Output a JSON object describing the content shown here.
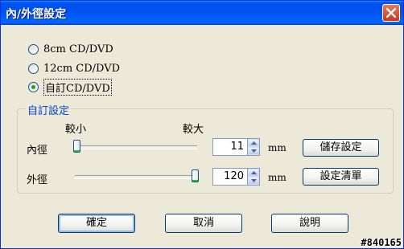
{
  "window": {
    "title": "內/外徑設定"
  },
  "disc_options": [
    {
      "label": "8cm CD/DVD",
      "checked": false
    },
    {
      "label": "12cm CD/DVD",
      "checked": false
    },
    {
      "label": "自訂CD/DVD",
      "checked": true
    }
  ],
  "custom_group": {
    "title": "自訂設定",
    "smaller_label": "較小",
    "larger_label": "較大",
    "inner": {
      "label": "內徑",
      "value": "11",
      "unit": "mm",
      "button": "儲存設定"
    },
    "outer": {
      "label": "外徑",
      "value": "120",
      "unit": "mm",
      "button": "設定清單"
    }
  },
  "buttons": {
    "ok": "確定",
    "cancel": "取消",
    "help": "說明"
  },
  "watermark": "#840165"
}
